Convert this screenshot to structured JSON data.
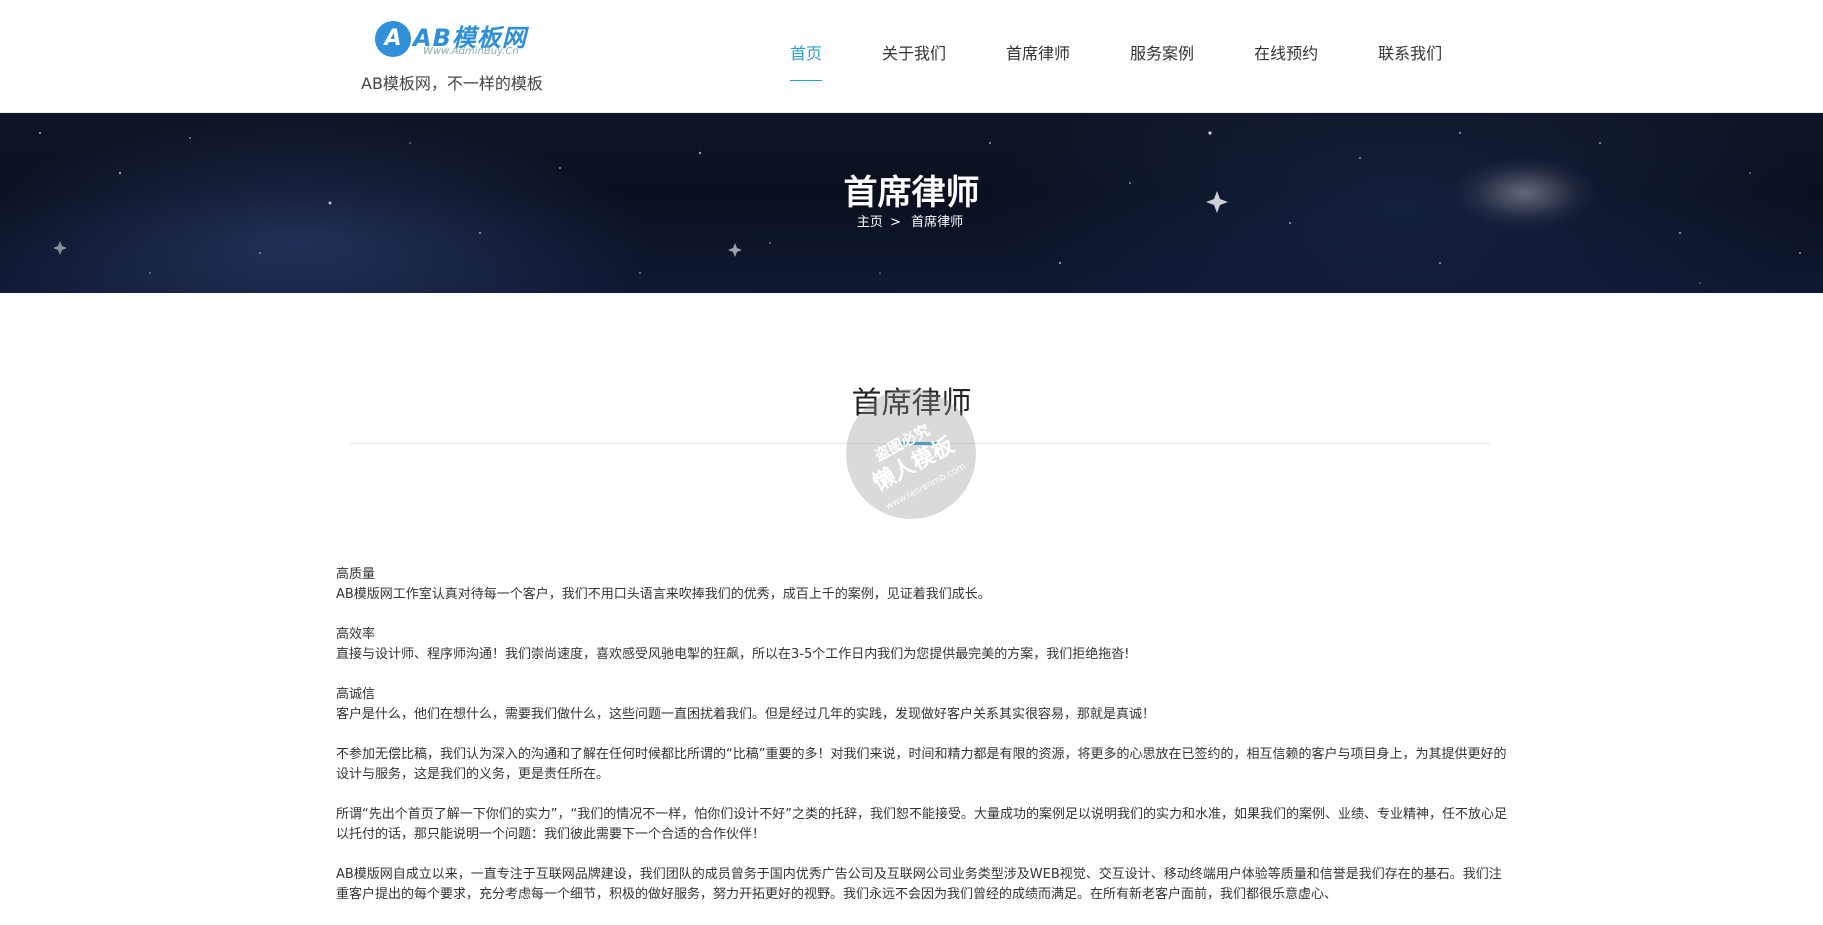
{
  "logo": {
    "mark": "A",
    "text": "AB模板网",
    "url": "Www.AdminBuy.Cn"
  },
  "slogan": "AB模板网，不一样的模板",
  "nav": [
    {
      "label": "首页",
      "active": true
    },
    {
      "label": "关于我们",
      "active": false
    },
    {
      "label": "首席律师",
      "active": false
    },
    {
      "label": "服务案例",
      "active": false
    },
    {
      "label": "在线预约",
      "active": false
    },
    {
      "label": "联系我们",
      "active": false
    }
  ],
  "banner": {
    "title": "首席律师",
    "breadcrumb_home": "主页",
    "breadcrumb_sep": ">",
    "breadcrumb_current": "首席律师"
  },
  "section": {
    "title": "首席律师"
  },
  "watermark": {
    "line1": "盗图必究",
    "line2": "懒人模板",
    "line3": "www.lanrenmb.com"
  },
  "content": [
    {
      "heading": "高质量",
      "text": "AB模版网工作室认真对待每一个客户，我们不用口头语言来吹捧我们的优秀，成百上千的案例，见证着我们成长。"
    },
    {
      "heading": "高效率",
      "text": "直接与设计师、程序师沟通！我们崇尚速度，喜欢感受风驰电掣的狂飙，所以在3-5个工作日内我们为您提供最完美的方案，我们拒绝拖沓!"
    },
    {
      "heading": "高诚信",
      "text": "客户是什么，他们在想什么，需要我们做什么，这些问题一直困扰着我们。但是经过几年的实践，发现做好客户关系其实很容易，那就是真诚！"
    },
    {
      "heading": "",
      "text": "不参加无偿比稿，我们认为深入的沟通和了解在任何时候都比所谓的“比稿”重要的多！对我们来说，时间和精力都是有限的资源，将更多的心思放在已签约的，相互信赖的客户与项目身上，为其提供更好的设计与服务，这是我们的义务，更是责任所在。"
    },
    {
      "heading": "",
      "text": "所谓“先出个首页了解一下你们的实力”，“我们的情况不一样，怕你们设计不好”之类的托辞，我们恕不能接受。大量成功的案例足以说明我们的实力和水准，如果我们的案例、业绩、专业精神，任不放心足以托付的话，那只能说明一个问题：我们彼此需要下一个合适的合作伙伴！"
    },
    {
      "heading": "",
      "text": "AB模版网自成立以来，一直专注于互联网品牌建设，我们团队的成员曾务于国内优秀广告公司及互联网公司业务类型涉及WEB视觉、交互设计、移动终端用户体验等质量和信誉是我们存在的基石。我们注重客户提出的每个要求，充分考虑每一个细节，积极的做好服务，努力开拓更好的视野。我们永远不会因为我们曾经的成绩而满足。在所有新老客户面前，我们都很乐意虚心、"
    }
  ],
  "colors": {
    "accent": "#2aa0d6",
    "logo": "#2f8fd8"
  }
}
